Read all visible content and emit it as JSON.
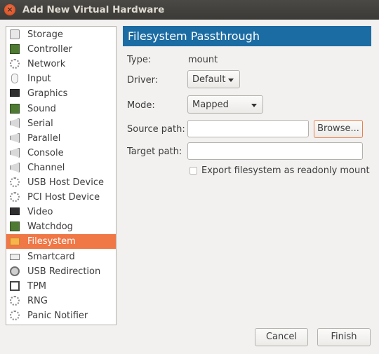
{
  "window": {
    "title": "Add New Virtual Hardware"
  },
  "sidebar": {
    "items": [
      {
        "label": "Storage",
        "icon": "hard-disk-icon"
      },
      {
        "label": "Controller",
        "icon": "chip-icon"
      },
      {
        "label": "Network",
        "icon": "network-icon"
      },
      {
        "label": "Input",
        "icon": "mouse-icon"
      },
      {
        "label": "Graphics",
        "icon": "monitor-icon"
      },
      {
        "label": "Sound",
        "icon": "sound-card-icon"
      },
      {
        "label": "Serial",
        "icon": "serial-port-icon"
      },
      {
        "label": "Parallel",
        "icon": "parallel-port-icon"
      },
      {
        "label": "Console",
        "icon": "console-port-icon"
      },
      {
        "label": "Channel",
        "icon": "channel-port-icon"
      },
      {
        "label": "USB Host Device",
        "icon": "usb-device-icon"
      },
      {
        "label": "PCI Host Device",
        "icon": "pci-device-icon"
      },
      {
        "label": "Video",
        "icon": "video-monitor-icon"
      },
      {
        "label": "Watchdog",
        "icon": "watchdog-icon"
      },
      {
        "label": "Filesystem",
        "icon": "folder-icon"
      },
      {
        "label": "Smartcard",
        "icon": "smartcard-icon"
      },
      {
        "label": "USB Redirection",
        "icon": "usb-redirection-icon"
      },
      {
        "label": "TPM",
        "icon": "tpm-icon"
      },
      {
        "label": "RNG",
        "icon": "rng-icon"
      },
      {
        "label": "Panic Notifier",
        "icon": "panic-notifier-icon"
      }
    ],
    "selected": "Filesystem",
    "selected_color": "#f07746"
  },
  "main": {
    "header": "Filesystem Passthrough",
    "header_color": "#1c6ca4",
    "type_label": "Type:",
    "type_value": "mount",
    "driver_label": "Driver:",
    "driver_value": "Default",
    "mode_label": "Mode:",
    "mode_value": "Mapped",
    "source_label": "Source path:",
    "source_value": "",
    "browse_label": "Browse...",
    "target_label": "Target path:",
    "target_value": "",
    "readonly_label": "Export filesystem as readonly mount",
    "readonly_checked": false
  },
  "footer": {
    "cancel_label": "Cancel",
    "finish_label": "Finish"
  }
}
